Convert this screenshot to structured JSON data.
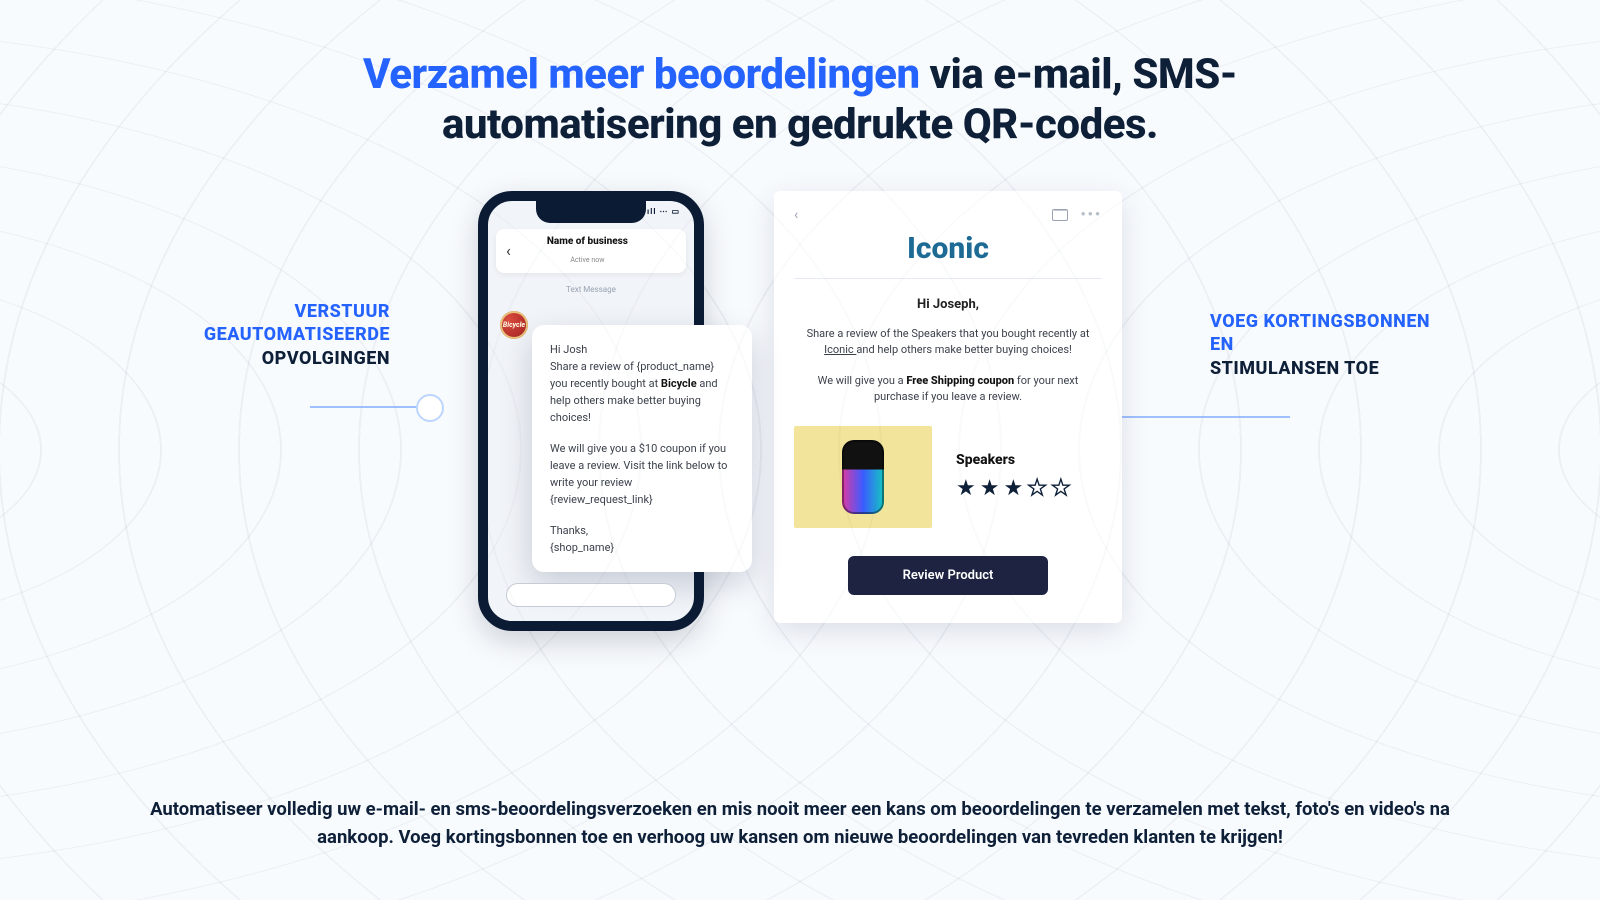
{
  "headline": {
    "accent": "Verzamel meer beoordelingen",
    "rest": " via e-mail, SMS-automatisering en gedrukte QR-codes."
  },
  "callouts": {
    "left": {
      "accent": "VERSTUUR GEAUTOMATISEERDE",
      "rest": "OPVOLGINGEN"
    },
    "right": {
      "accent": "VOEG KORTINGSBONNEN EN",
      "rest": "STIMULANSEN TOE"
    }
  },
  "phone": {
    "signal": "••ıll ⋯ ▭",
    "business": "Name of business",
    "subtitle": "Active now",
    "badge": "Text Message",
    "avatar_label": "Bicycle",
    "msg": {
      "greet": "Hi Josh",
      "p1a": "Share a review of {product_name} you recently bought at ",
      "p1b": "Bicycle",
      "p1c": " and help others make better buying choices!",
      "p2": "We will give you a $10 coupon if you leave a review. Visit the link below to write your review {review_request_link}",
      "sign1": "Thanks,",
      "sign2": "{shop_name}"
    }
  },
  "email": {
    "back": "‹",
    "dots": "•••",
    "brand": "Iconic",
    "greet": "Hi Joseph,",
    "p1a": "Share a review of the Speakers that you bought recently at ",
    "p1b": "Iconic ",
    "p1c": "and help others make better buying choices!",
    "p2a": "We will give you a ",
    "p2b": "Free Shipping coupon",
    "p2c": " for your next purchase if you leave a review.",
    "product": {
      "name": "Speakers",
      "rating": 3,
      "scale": 5
    },
    "cta": "Review Product"
  },
  "bottom": "Automatiseer volledig uw e-mail- en sms-beoordelingsverzoeken en mis nooit meer een kans om beoordelingen te verzamelen met tekst, foto's en video's na aankoop. Voeg kortingsbonnen toe en verhoog uw kansen om nieuwe beoordelingen van tevreden klanten te krijgen!"
}
